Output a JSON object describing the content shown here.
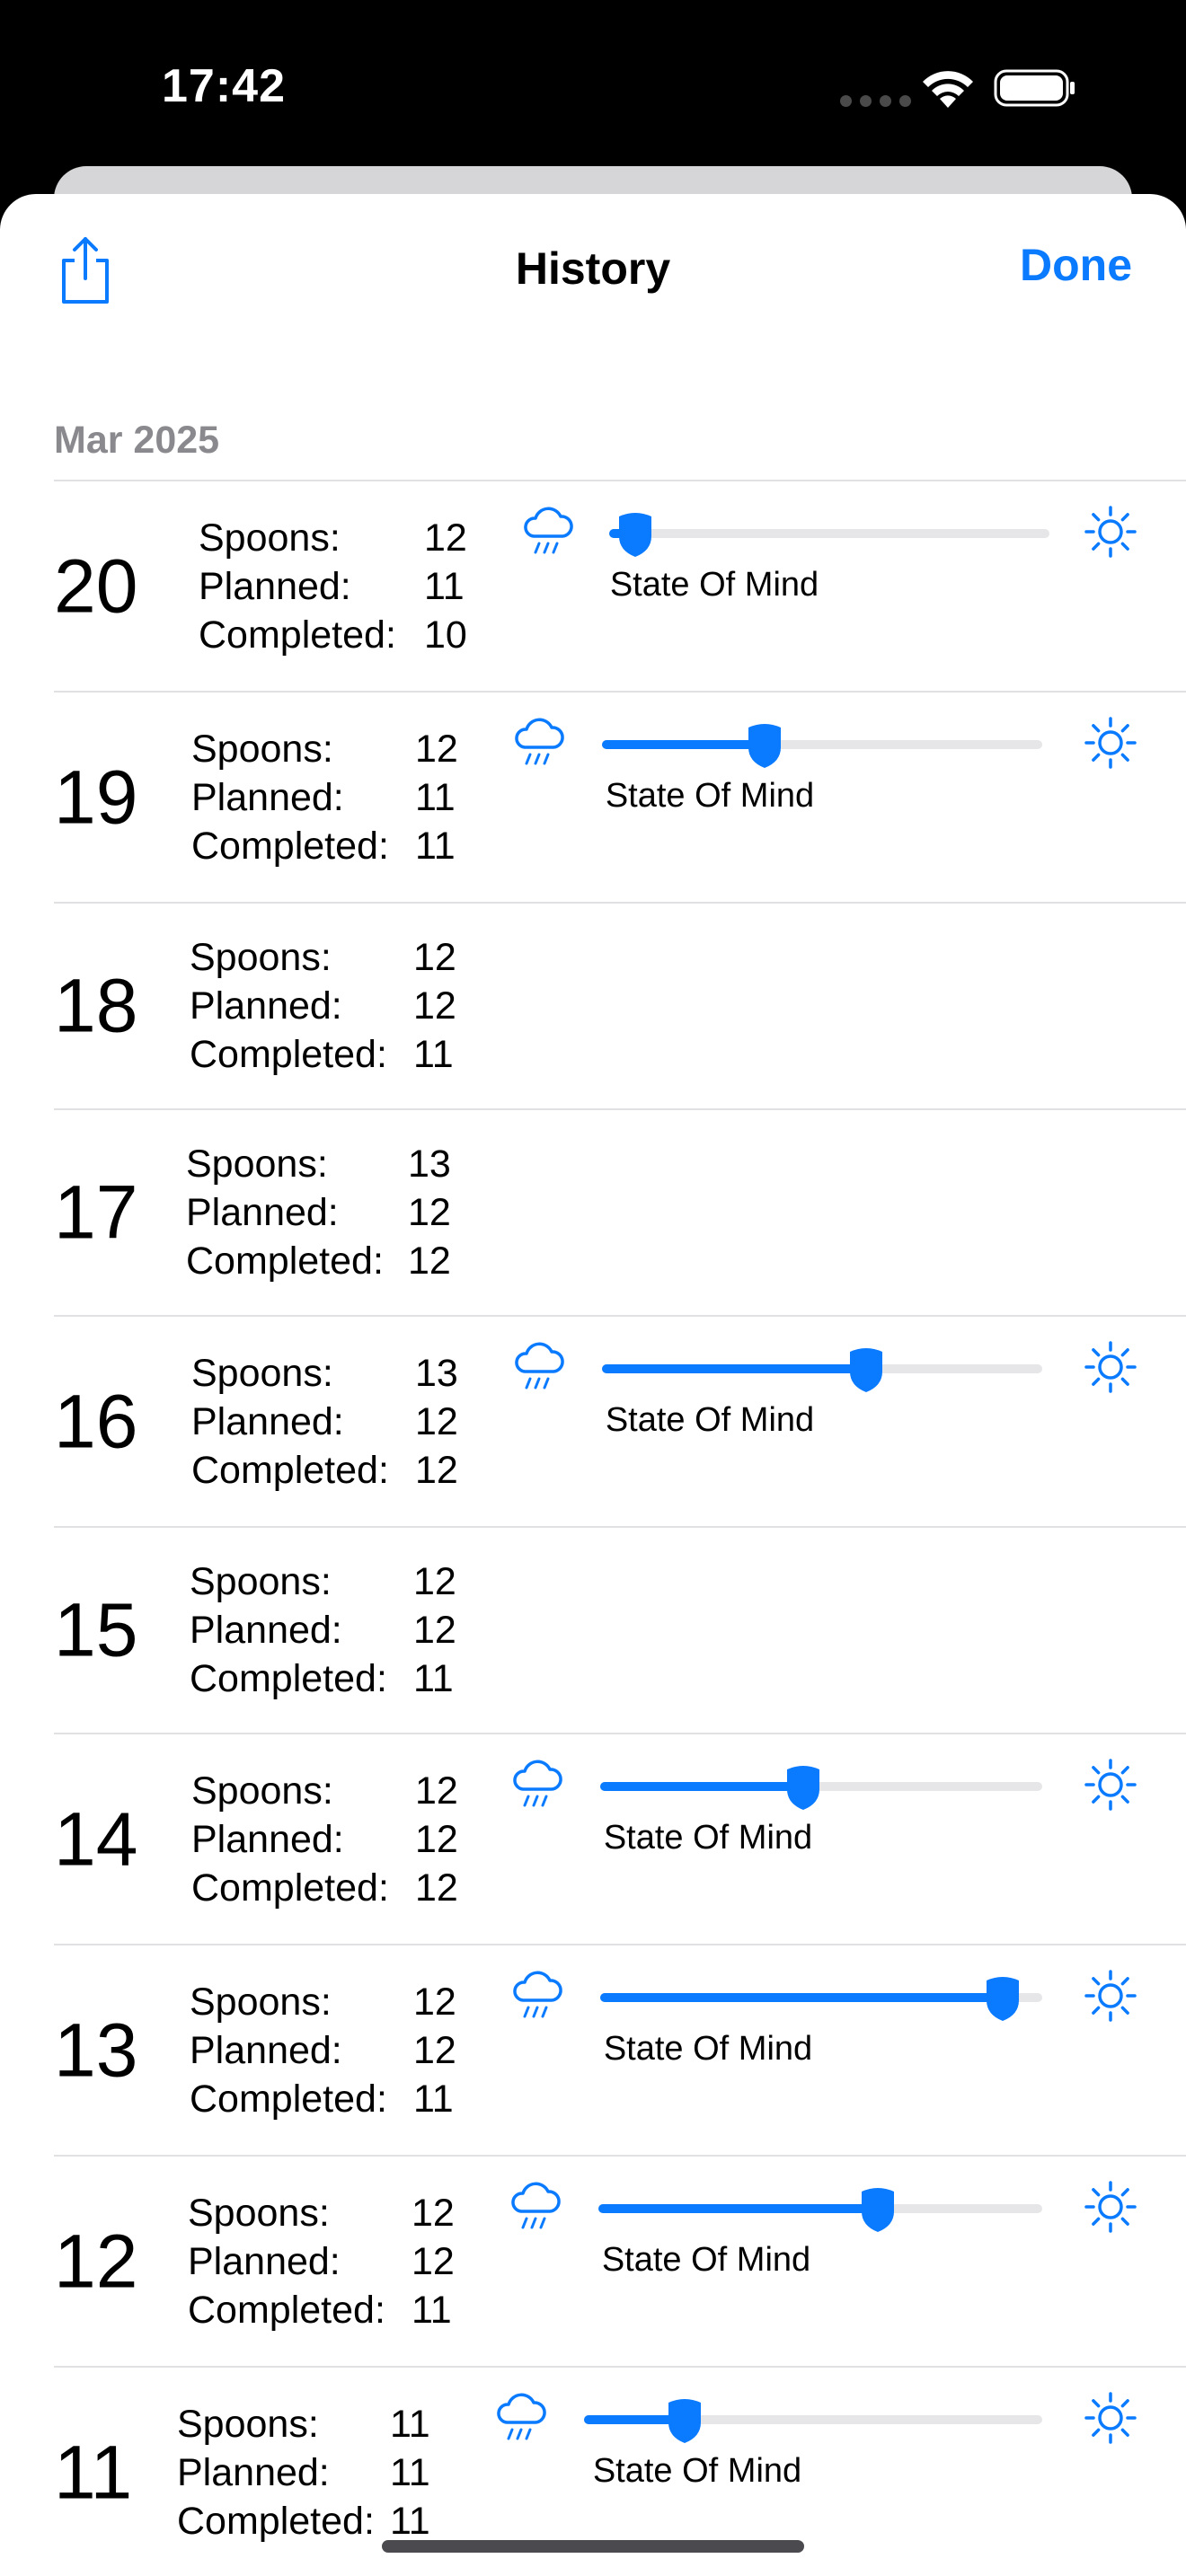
{
  "status_bar": {
    "time": "17:42"
  },
  "nav": {
    "title": "History",
    "done_label": "Done"
  },
  "section": {
    "title": "Mar 2025"
  },
  "labels": {
    "spoons": "Spoons:",
    "planned": "Planned:",
    "completed": "Completed:",
    "state_of_mind": "State Of Mind"
  },
  "colors": {
    "accent": "#0a7aff",
    "divider": "#e1e1e4",
    "section_header": "#8a8a8e"
  },
  "icons": {
    "share": "share-icon",
    "rain": "cloud-rain-icon",
    "sun": "sun-icon",
    "wifi": "wifi-icon",
    "battery": "battery-icon"
  },
  "days": [
    {
      "day": "20",
      "spoons": "12",
      "planned": "11",
      "completed": "10",
      "state_of_mind": 0.06
    },
    {
      "day": "19",
      "spoons": "12",
      "planned": "11",
      "completed": "11",
      "state_of_mind": 0.37
    },
    {
      "day": "18",
      "spoons": "12",
      "planned": "12",
      "completed": "11",
      "state_of_mind": null
    },
    {
      "day": "17",
      "spoons": "13",
      "planned": "12",
      "completed": "12",
      "state_of_mind": null
    },
    {
      "day": "16",
      "spoons": "13",
      "planned": "12",
      "completed": "12",
      "state_of_mind": 0.6
    },
    {
      "day": "15",
      "spoons": "12",
      "planned": "12",
      "completed": "11",
      "state_of_mind": null
    },
    {
      "day": "14",
      "spoons": "12",
      "planned": "12",
      "completed": "12",
      "state_of_mind": 0.46
    },
    {
      "day": "13",
      "spoons": "12",
      "planned": "12",
      "completed": "11",
      "state_of_mind": 0.91
    },
    {
      "day": "12",
      "spoons": "12",
      "planned": "12",
      "completed": "11",
      "state_of_mind": 0.63
    },
    {
      "day": "11",
      "spoons": "11",
      "planned": "11",
      "completed": "11",
      "state_of_mind": 0.22
    }
  ]
}
